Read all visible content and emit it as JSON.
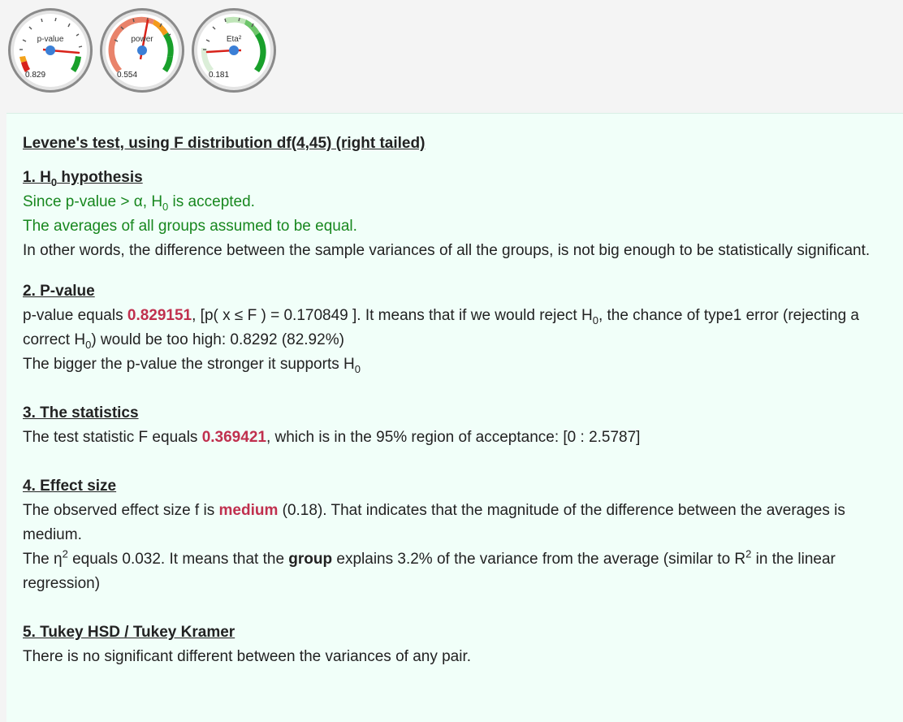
{
  "gauges": [
    {
      "label": "p-value",
      "value": "0.829"
    },
    {
      "label": "power",
      "value": "0.554"
    },
    {
      "label": "Eta²",
      "value": "0.181"
    }
  ],
  "result": {
    "title": "Levene's test, using F distribution df(4,45) (right tailed)",
    "s1": {
      "heading_a": "1. H",
      "heading_sub": "0",
      "heading_b": " hypothesis",
      "line1_a": "Since p-value > α, H",
      "line1_sub": "0",
      "line1_b": " is accepted.",
      "line2": "The averages of all groups assumed to be equal.",
      "line3": "In other words, the difference between the sample variances of all the groups, is not big enough to be statistically significant."
    },
    "s2": {
      "heading": "2. P-value",
      "t1": "p-value equals ",
      "pvalue": "0.829151",
      "t2": ", [p( x ≤ F ) = 0.170849 ]. It means that if we would reject H",
      "sub1": "0",
      "t3": ", the chance of type1 error (rejecting a correct H",
      "sub2": "0",
      "t4": ") would be too high: 0.8292 (82.92%)",
      "line2_a": "The bigger the p-value the stronger it supports H",
      "line2_sub": "0"
    },
    "s3": {
      "heading": "3. The statistics",
      "t1": "The test statistic F equals ",
      "fvalue": "0.369421",
      "t2": ", which is in the 95% region of acceptance: [0 : 2.5787]"
    },
    "s4": {
      "heading": "4. Effect size",
      "t1": "The observed effect size f is ",
      "effect": "medium",
      "t2": " (0.18). That indicates that the magnitude of the difference between the averages is medium.",
      "l2_a": "The η",
      "l2_sup": "2",
      "l2_b": " equals 0.032. It means that the ",
      "l2_group": "group",
      "l2_c": " explains 3.2% of the variance from the average (similar to R",
      "l2_sup2": "2",
      "l2_d": " in the linear regression)"
    },
    "s5": {
      "heading": "5. Tukey HSD / Tukey Kramer",
      "line": "There is no significant different between the variances of any pair."
    }
  }
}
